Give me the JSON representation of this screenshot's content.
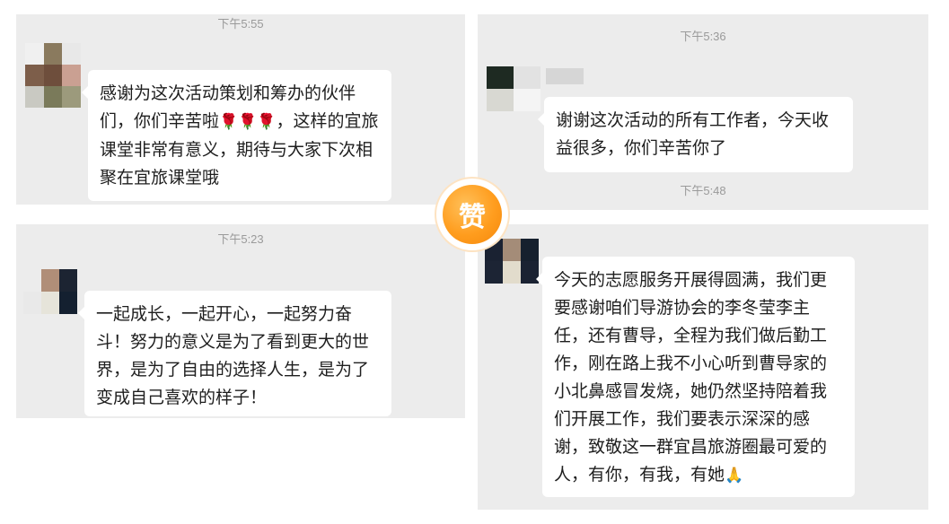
{
  "messages": [
    {
      "time": "下午5:55",
      "text_parts": [
        "感谢为这次活动策划和筹办的伙伴们，你们辛苦啦",
        "🌹🌹🌹",
        "，这样的宜旅课堂非常有意义，期待与大家下次相聚在宜旅课堂哦"
      ],
      "emoji_name": "rose-emoji"
    },
    {
      "time": "下午5:36",
      "text": "谢谢这次活动的所有工作者，今天收益很多，你们辛苦你了"
    },
    {
      "time": "下午5:23",
      "text": "一起成长，一起开心，一起努力奋斗！努力的意义是为了看到更大的世界，是为了自由的选择人生，是为了变成自己喜欢的样子！"
    },
    {
      "time": "下午5:48",
      "text_parts": [
        "今天的志愿服务开展得圆满，我们更要感谢咱们导游协会的李冬莹李主任，还有曹导，全程为我们做后勤工作，刚在路上我不小心听到曹导家的小北鼻感冒发烧，她仍然坚持陪着我们开展工作，我们要表示深深的感谢，致敬这一群宜昌旅游圈最可爱的人，有你，有我，有她",
        "🙏"
      ],
      "emoji_name": "folded-hands-emoji"
    }
  ],
  "badge": {
    "label": "赞",
    "icon": "like-badge-icon"
  },
  "colors": {
    "panel_bg": "#ececec",
    "bubble_bg": "#ffffff",
    "timestamp": "#9a9a9a",
    "badge_orange": "#ff9d1e"
  }
}
